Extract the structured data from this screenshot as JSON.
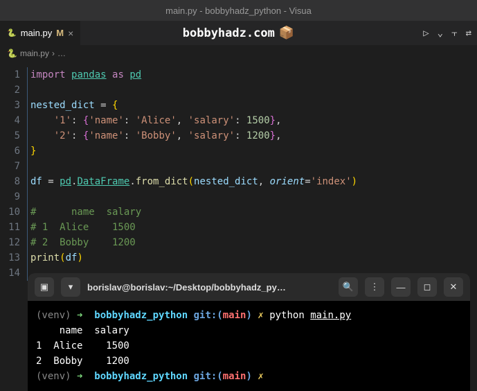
{
  "title_bar": "main.py - bobbyhadz_python - Visua",
  "tab": {
    "name": "main.py",
    "modified_indicator": "M",
    "close": "×"
  },
  "brand": "bobbyhadz.com",
  "breadcrumb": {
    "file": "main.py",
    "sep": "›",
    "more": "…"
  },
  "code": {
    "l1": {
      "import": "import",
      "pandas": "pandas",
      "as": "as",
      "pd": "pd"
    },
    "l3": {
      "var": "nested_dict",
      "eq": " = ",
      "brace": "{"
    },
    "l4": {
      "k": "'1'",
      "colon": ": ",
      "ob": "{",
      "nk": "'name'",
      "nv": "'Alice'",
      "sk": "'salary'",
      "sv": "1500",
      "cb": "}",
      "comma": ","
    },
    "l5": {
      "k": "'2'",
      "colon": ": ",
      "ob": "{",
      "nk": "'name'",
      "nv": "'Bobby'",
      "sk": "'salary'",
      "sv": "1200",
      "cb": "}",
      "comma": ","
    },
    "l6": {
      "brace": "}"
    },
    "l8": {
      "df": "df",
      "eq": " = ",
      "pd": "pd",
      "dot": ".",
      "dataframe": "DataFrame",
      "from_dict": "from_dict",
      "op": "(",
      "arg1": "nested_dict",
      "comma": ", ",
      "orient": "orient",
      "eq2": "=",
      "idx": "'index'",
      "cp": ")"
    },
    "l10": "#      name  salary",
    "l11": "# 1  Alice    1500",
    "l12": "# 2  Bobby    1200",
    "l13": {
      "print": "print",
      "op": "(",
      "df": "df",
      "cp": ")"
    }
  },
  "line_numbers": [
    "1",
    "2",
    "3",
    "4",
    "5",
    "6",
    "7",
    "8",
    "9",
    "10",
    "11",
    "12",
    "13",
    "14"
  ],
  "terminal": {
    "title": "borislav@borislav:~/Desktop/bobbyhadz_py…",
    "lines": {
      "p1": {
        "venv": "(venv)",
        "arrow": " ➜  ",
        "dir": "bobbyhadz_python",
        "git": " git:(",
        "branch": "main",
        "gitc": ")",
        "x": " ✗ ",
        "cmd": "python ",
        "file": "main.py"
      },
      "out1": "    name  salary",
      "out2": "1  Alice    1500",
      "out3": "2  Bobby    1200",
      "p2": {
        "venv": "(venv)",
        "arrow": " ➜  ",
        "dir": "bobbyhadz_python",
        "git": " git:(",
        "branch": "main",
        "gitc": ")",
        "x": " ✗ "
      }
    }
  }
}
